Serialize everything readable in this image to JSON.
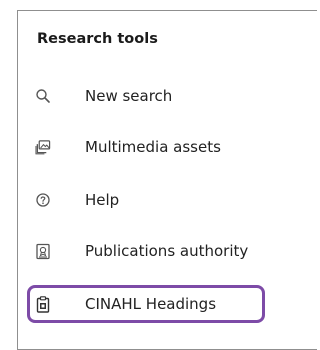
{
  "panel": {
    "title": "Research tools",
    "items": [
      {
        "label": "New search",
        "icon": "search-icon"
      },
      {
        "label": "Multimedia assets",
        "icon": "images-icon"
      },
      {
        "label": "Help",
        "icon": "help-icon"
      },
      {
        "label": "Publications authority",
        "icon": "authority-icon"
      },
      {
        "label": "CINAHL Headings",
        "icon": "clipboard-icon",
        "selected": true
      }
    ]
  },
  "colors": {
    "highlight": "#7d4ba7",
    "text": "#222222",
    "icon": "#555555"
  }
}
